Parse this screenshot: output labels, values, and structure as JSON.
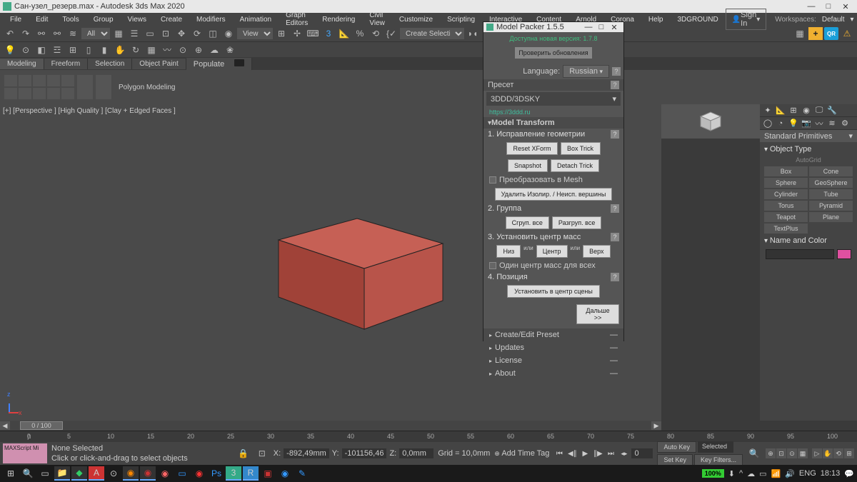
{
  "title": "Сан-узел_резерв.max - Autodesk 3ds Max 2020",
  "menus": [
    "File",
    "Edit",
    "Tools",
    "Group",
    "Views",
    "Create",
    "Modifiers",
    "Animation",
    "Graph Editors",
    "Rendering",
    "Civil View",
    "Customize",
    "Scripting",
    "Interactive",
    "Content",
    "Arnold",
    "Corona",
    "Help",
    "3DGROUND"
  ],
  "signin": "Sign In",
  "workspace_label": "Workspaces:",
  "workspace_value": "Default",
  "toolbar_dropdown_all": "All",
  "toolbar_dropdown_view": "View",
  "toolbar_dropdown_create": "Create Selection Se",
  "qr": "QR",
  "ribbon_tabs": [
    "Modeling",
    "Freeform",
    "Selection",
    "Object Paint",
    "Populate"
  ],
  "ribbon_group_label": "Polygon Modeling",
  "viewport_label": "[+] [Perspective ] [High Quality ] [Clay + Edged Faces ]",
  "modal": {
    "title": "Model Packer 1.5.5",
    "update": "Доступна новая версия: 1.7.8",
    "check": "Проверить обновления",
    "lang_label": "Language:",
    "lang_value": "Russian",
    "preset_head": "Пресет",
    "preset_value": "3DDD/3DSKY",
    "link": "https://3ddd.ru",
    "transform_head": "Model Transform",
    "step1": "1. Исправление геометрии",
    "reset": "Reset XForm",
    "boxtrick": "Box Trick",
    "snapshot": "Snapshot",
    "detach": "Detach Trick",
    "tomesh": "Преобразовать в Mesh",
    "isolate": "Удалить Изолир. / Неисп. вершины",
    "step2": "2. Группа",
    "group": "Сгруп. все",
    "ungroup": "Разгруп. все",
    "step3": "3. Установить центр масс",
    "bottom": "Низ",
    "or": "или",
    "center": "Центр",
    "top": "Верх",
    "onecenter": "Один центр масс для всех",
    "step4": "4. Позиция",
    "setcenter": "Установить в центр сцены",
    "next": "Дальше >>",
    "sections": [
      "Create/Edit Preset",
      "Updates",
      "License",
      "About"
    ]
  },
  "rightpanel": {
    "title": "Standard Primitives",
    "objtype": "Object Type",
    "autogrid": "AutoGrid",
    "objects": [
      "Box",
      "Cone",
      "Sphere",
      "GeoSphere",
      "Cylinder",
      "Tube",
      "Torus",
      "Pyramid",
      "Teapot",
      "Plane",
      "TextPlus"
    ],
    "namecolor": "Name and Color"
  },
  "timeslider_value": "0 / 100",
  "ruler_ticks": [
    0,
    5,
    10,
    15,
    20,
    25,
    30,
    35,
    40,
    45,
    50,
    55,
    60,
    65,
    70,
    75,
    80,
    85,
    90,
    95,
    100
  ],
  "status": {
    "script": "MAXScript Mi",
    "none": "None Selected",
    "hint": "Click or click-and-drag to select objects",
    "x_label": "X:",
    "x": "-892,49mm",
    "y_label": "Y:",
    "y": "-101156,46",
    "z_label": "Z:",
    "z": "0,0mm",
    "grid": "Grid = 10,0mm",
    "addtime": "Add Time Tag",
    "zero": "0",
    "autokey": "Auto Key",
    "selected": "Selected",
    "setkey": "Set Key",
    "keyfilters": "Key Filters..."
  },
  "taskbar": {
    "battery": "100%",
    "lang": "ENG",
    "time": "18:13"
  }
}
